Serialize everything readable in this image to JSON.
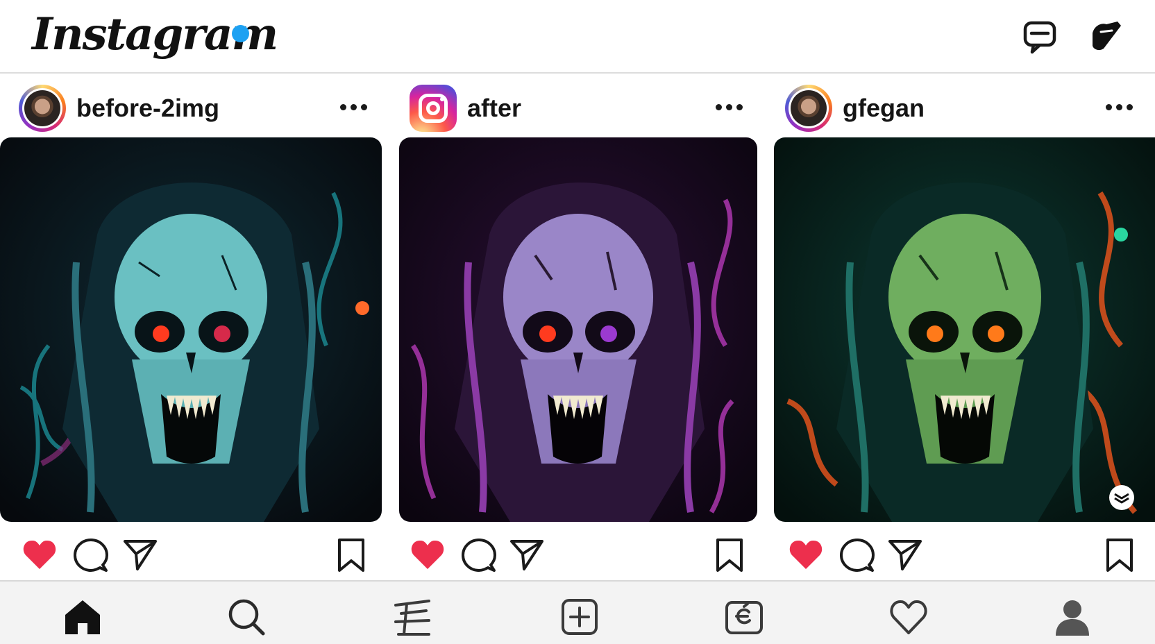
{
  "app": {
    "brand": "Instagram",
    "logo_text": "Instagram",
    "accent_dot_color": "#1da1f2",
    "header_icons": [
      "messages-icon",
      "edit-pen-icon"
    ]
  },
  "posts": [
    {
      "username": "before-2img",
      "avatar": "user-avatar",
      "image_palette": "teal",
      "liked": true,
      "actions": [
        "like-icon",
        "comment-icon",
        "share-icon",
        "bookmark-icon"
      ]
    },
    {
      "username": "after",
      "avatar": "instagram-logo-icon",
      "image_palette": "purple",
      "liked": true,
      "actions": [
        "like-icon",
        "comment-icon",
        "share-icon",
        "bookmark-icon"
      ]
    },
    {
      "username": "gfegan",
      "avatar": "user-avatar",
      "image_palette": "green",
      "liked": true,
      "has_overlay_badge": true,
      "actions": [
        "like-icon",
        "comment-icon",
        "share-icon",
        "bookmark-icon"
      ]
    }
  ],
  "colors": {
    "like_red": "#ed2f4d",
    "icon_dark": "#1a1a1a",
    "nav_background": "#f3f3f3"
  },
  "bottom_nav": [
    "home-icon",
    "search-icon",
    "reels-icon",
    "create-icon",
    "shop-icon",
    "activity-icon",
    "profile-icon"
  ]
}
